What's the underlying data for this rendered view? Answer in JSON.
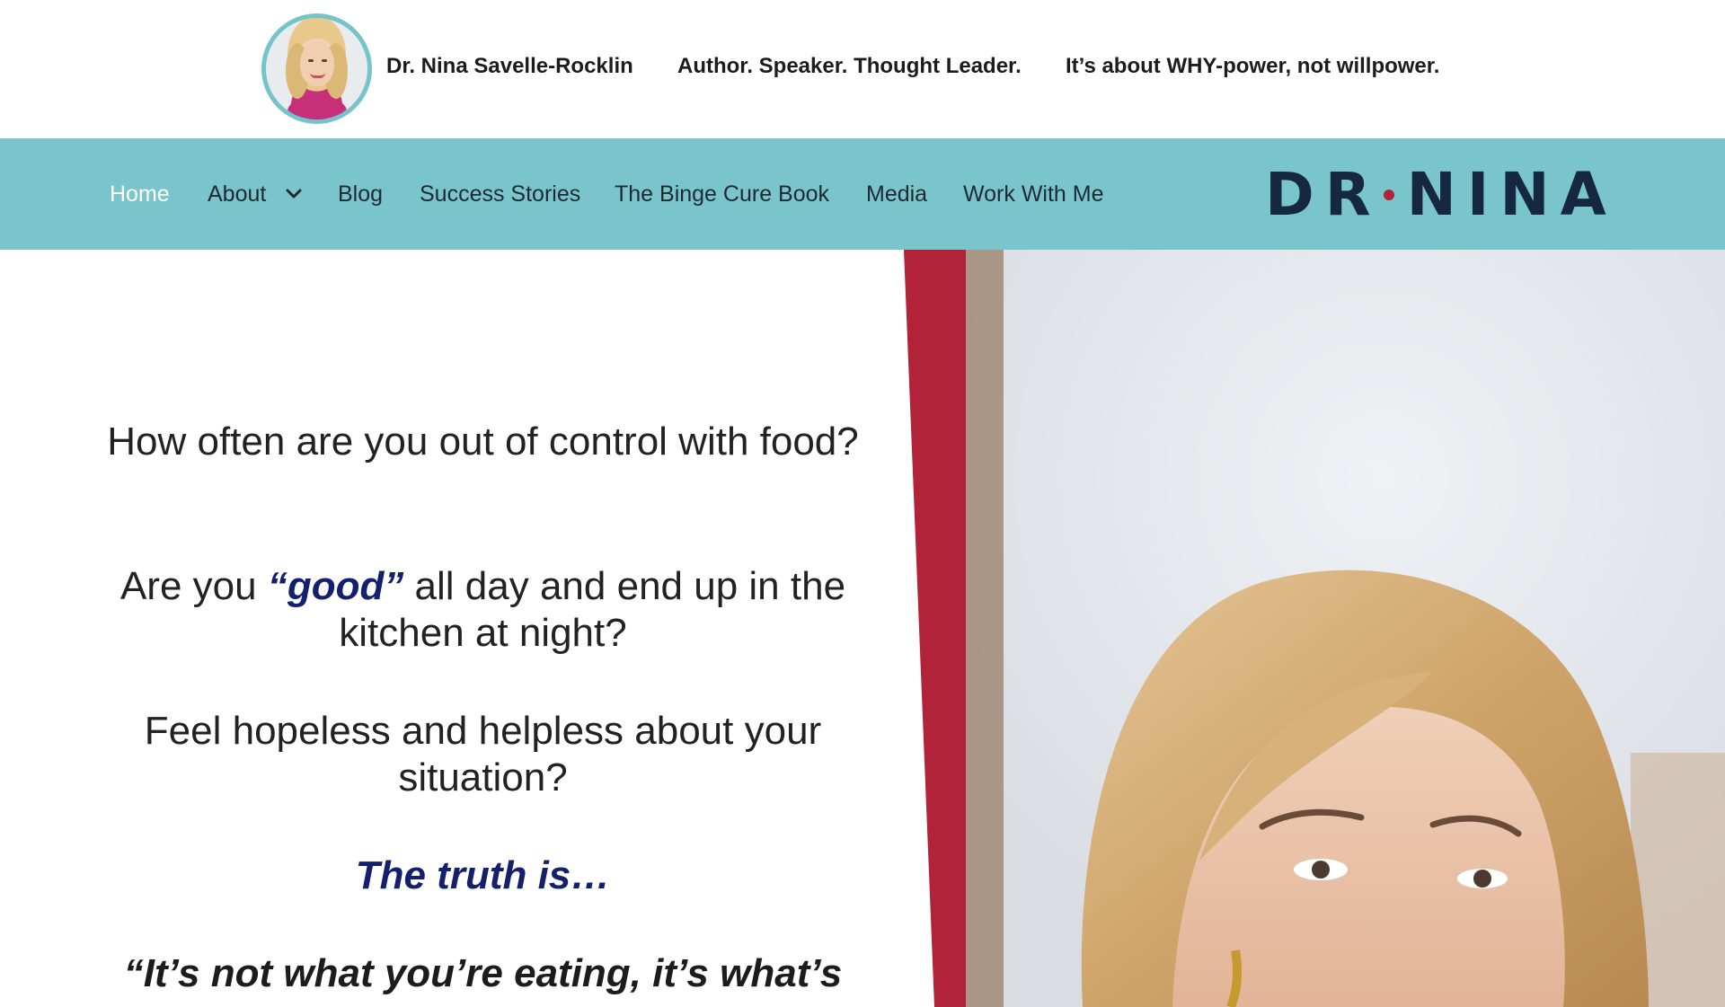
{
  "header": {
    "name": "Dr. Nina Savelle-Rocklin",
    "tagline": "Author. Speaker. Thought Leader.",
    "slogan": "It’s about WHY-power, not willpower."
  },
  "nav": {
    "items": [
      {
        "label": "Home",
        "active": true
      },
      {
        "label": "About",
        "has_dropdown": true
      },
      {
        "label": "Blog"
      },
      {
        "label": "Success Stories"
      },
      {
        "label": "The Binge Cure Book"
      },
      {
        "label": "Media"
      },
      {
        "label": "Work With Me"
      }
    ],
    "logo_left": "DR",
    "logo_right": "NINA",
    "background": "#7ac5cb"
  },
  "hero": {
    "q1": "How often are you out of control with food?",
    "q2_before": "Are you ",
    "q2_em": "“good”",
    "q2_after": " all day and end up in the kitchen at night?",
    "q3": "Feel hopeless and helpless about your situation?",
    "truth": "The truth is…",
    "quote_line1": "“It’s not what you’re eating, it’s what’s"
  },
  "colors": {
    "accent_red": "#b22238",
    "accent_navy": "#141f6e",
    "logo_navy": "#15283f",
    "avatar_ring": "#76c4cb"
  }
}
